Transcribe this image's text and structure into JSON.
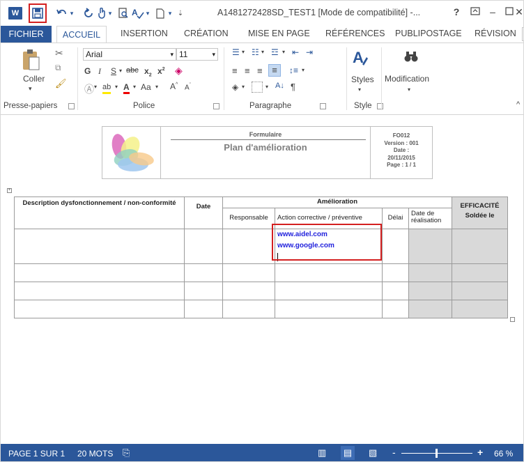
{
  "titlebar": {
    "doc_title": "A1481272428SD_TEST1 [Mode de compatibilité] -...",
    "help": "?",
    "word_logo": "W"
  },
  "tabs": {
    "file": "FICHIER",
    "items": [
      "ACCUEIL",
      "INSERTION",
      "CRÉATION",
      "MISE EN PAGE",
      "RÉFÉRENCES",
      "PUBLIPOSTAGE",
      "RÉVISION"
    ]
  },
  "ribbon": {
    "clipboard": {
      "paste_label": "Coller",
      "group_label": "Presse-papiers"
    },
    "font": {
      "font_name": "Arial",
      "font_size": "11",
      "group_label": "Police",
      "aa_label": "Aa"
    },
    "paragraph": {
      "group_label": "Paragraphe"
    },
    "styles": {
      "styles_label": "Styles",
      "group_label": "Style"
    },
    "editing": {
      "modification_label": "Modification"
    }
  },
  "doc_header": {
    "form_label": "Formulaire",
    "title": "Plan d'amélioration",
    "code": "FO012",
    "version": "Version : 001",
    "date_label": "Date :",
    "date_value": "20/11/2015",
    "page": "Page : 1 / 1"
  },
  "table": {
    "col_description": "Description dysfonctionnement / non-conformité",
    "col_date": "Date",
    "group_amelioration": "Amélioration",
    "col_responsable": "Responsable",
    "col_action": "Action corrective / préventive",
    "col_delai": "Délai",
    "col_date_real_1": "Date de",
    "col_date_real_2": "réalisation",
    "col_efficacite": "EFFICACITÉ",
    "col_soldee": "Soldée le",
    "action_links": [
      "www.aidel.com",
      "www.google.com"
    ]
  },
  "statusbar": {
    "page": "PAGE 1 SUR 1",
    "words": "20 MOTS",
    "zoom": "66 %",
    "zoom_minus": "-",
    "zoom_plus": "+"
  },
  "colors": {
    "accent": "#2b579a",
    "highlight_box": "#d42020",
    "link": "#1f1fdc"
  }
}
